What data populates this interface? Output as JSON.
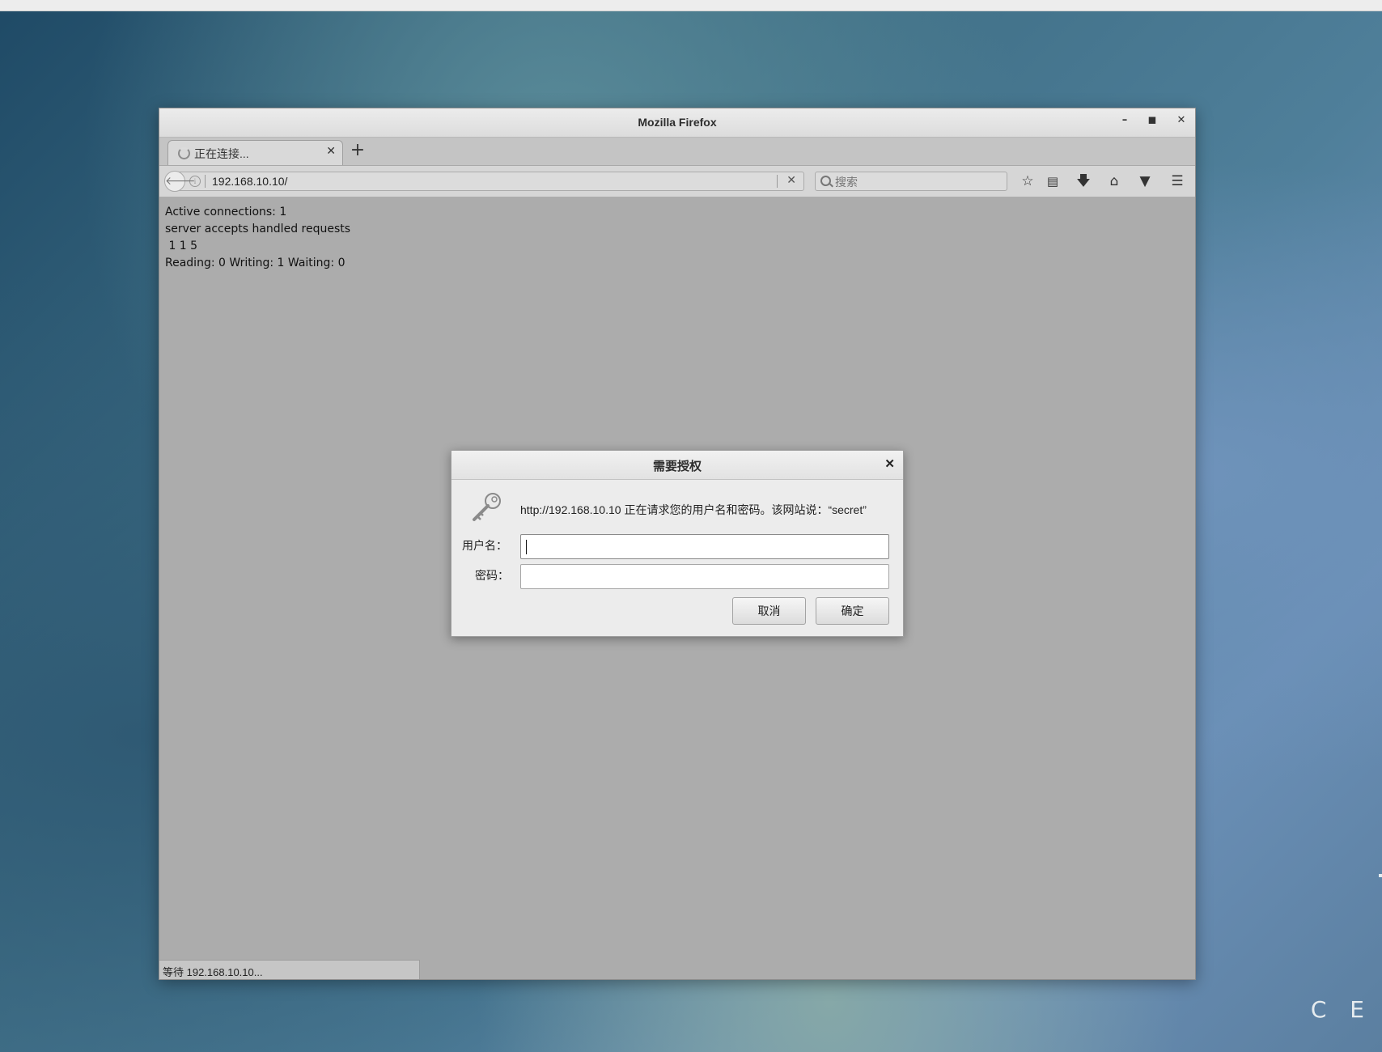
{
  "window": {
    "title": "Mozilla Firefox",
    "tab_label": "正在连接...",
    "url": "192.168.10.10/",
    "search_placeholder": "搜索",
    "status_text": "等待 192.168.10.10..."
  },
  "page": {
    "lines": [
      "Active connections: 1",
      "server accepts handled requests",
      " 1 1 5",
      "Reading: 0 Writing: 1 Waiting: 0"
    ]
  },
  "dialog": {
    "title": "需要授权",
    "message": "http://192.168.10.10 正在请求您的用户名和密码。该网站说：“secret”",
    "username_label": "用户名：",
    "password_label": "密码：",
    "username_value": "",
    "password_value": "",
    "cancel_label": "取消",
    "ok_label": "确定"
  },
  "desktop": {
    "corner_text": "C E"
  }
}
